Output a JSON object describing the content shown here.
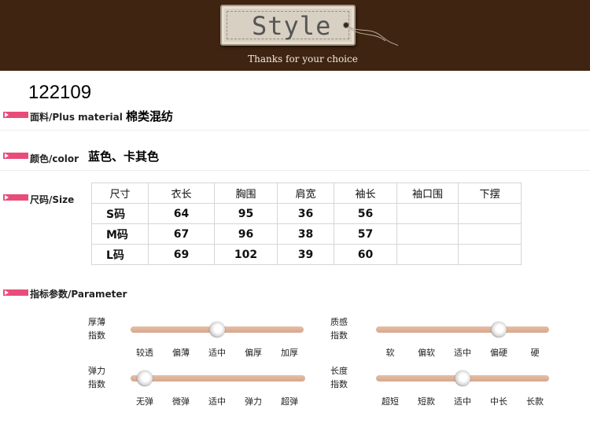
{
  "header": {
    "tag_text": "Style",
    "tagline": "Thanks for your choice"
  },
  "product": {
    "code": "122109"
  },
  "material": {
    "label": "面料/Plus material",
    "value": "棉类混纺"
  },
  "color": {
    "label": "颜色/color",
    "value": "蓝色、卡其色"
  },
  "size": {
    "label": "尺码/Size",
    "columns": [
      "尺寸",
      "衣长",
      "胸围",
      "肩宽",
      "袖长",
      "袖口围",
      "下摆"
    ],
    "rows": [
      [
        "S码",
        "64",
        "95",
        "36",
        "56",
        "",
        ""
      ],
      [
        "M码",
        "67",
        "96",
        "38",
        "57",
        "",
        ""
      ],
      [
        "L码",
        "69",
        "102",
        "39",
        "60",
        "",
        ""
      ]
    ]
  },
  "parameter": {
    "label": "指标参数/Parameter",
    "sliders": [
      {
        "title": [
          "厚薄",
          "指数"
        ],
        "options": [
          "较透",
          "偏薄",
          "适中",
          "偏厚",
          "加厚"
        ],
        "selected_index": 2
      },
      {
        "title": [
          "质感",
          "指数"
        ],
        "options": [
          "软",
          "偏软",
          "适中",
          "偏硬",
          "硬"
        ],
        "selected_index": 3
      },
      {
        "title": [
          "弹力",
          "指数"
        ],
        "options": [
          "无弹",
          "微弹",
          "适中",
          "弹力",
          "超弹"
        ],
        "selected_index": 0
      },
      {
        "title": [
          "长度",
          "指数"
        ],
        "options": [
          "超短",
          "短款",
          "适中",
          "中长",
          "长款"
        ],
        "selected_index": 2
      }
    ]
  },
  "colors": {
    "header_bg": "#3f2412",
    "accent_marker": "#e84d7a",
    "slider_track": "#dcae95"
  }
}
